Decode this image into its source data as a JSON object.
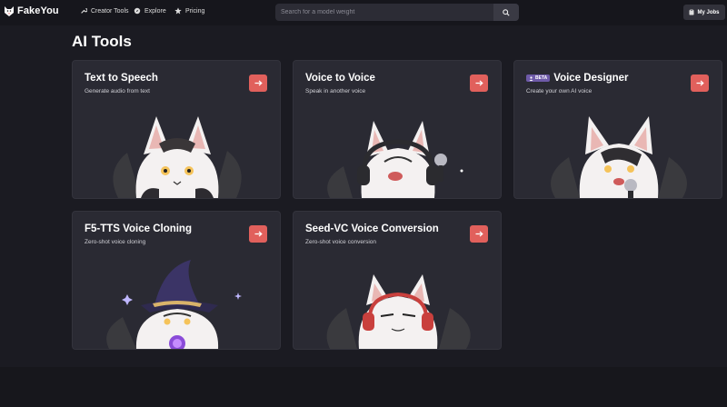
{
  "brand": {
    "name": "FakeYou",
    "accent": "#e1605c"
  },
  "nav": [
    {
      "label": "Creator Tools",
      "icon": "wrench-icon"
    },
    {
      "label": "Explore",
      "icon": "compass-icon"
    },
    {
      "label": "Pricing",
      "icon": "star-icon"
    }
  ],
  "search": {
    "placeholder": "Search for a model weight",
    "value": ""
  },
  "header": {
    "my_jobs_label": "My Jobs"
  },
  "page": {
    "title": "AI Tools"
  },
  "cards": [
    {
      "title": "Text to Speech",
      "subtitle": "Generate audio from text"
    },
    {
      "title": "Voice to Voice",
      "subtitle": "Speak in another voice"
    },
    {
      "title": "Voice Designer",
      "subtitle": "Create your own AI voice",
      "badge": "BETA"
    },
    {
      "title": "F5-TTS Voice Cloning",
      "subtitle": "Zero-shot voice cloning"
    },
    {
      "title": "Seed-VC Voice Conversion",
      "subtitle": "Zero-shot voice conversion"
    }
  ]
}
